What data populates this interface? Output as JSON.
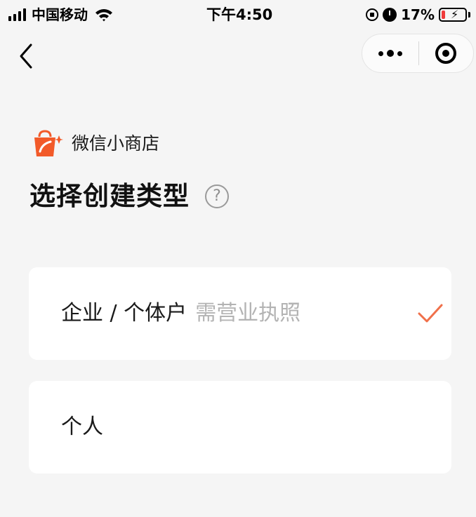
{
  "status_bar": {
    "carrier": "中国移动",
    "time": "下午4:50",
    "battery_percent_text": "17%",
    "battery_level": 0.17,
    "battery_color": "#ef3b3b"
  },
  "nav": {
    "back_icon": "chevron-left-icon",
    "more_icon": "more-dots-icon",
    "close_icon": "target-circle-icon"
  },
  "brand": {
    "name": "微信小商店",
    "logo_icon": "shopping-bag-icon",
    "logo_color": "#f25a29"
  },
  "page": {
    "title": "选择创建类型",
    "help_symbol": "?"
  },
  "options": [
    {
      "label": "企业 / 个体户",
      "hint": "需营业执照",
      "selected": true
    },
    {
      "label": "个人",
      "hint": "",
      "selected": false
    }
  ],
  "colors": {
    "background": "#f5f5f5",
    "card": "#ffffff",
    "accent": "#f0704a",
    "hint_text": "#b3b3b3"
  }
}
